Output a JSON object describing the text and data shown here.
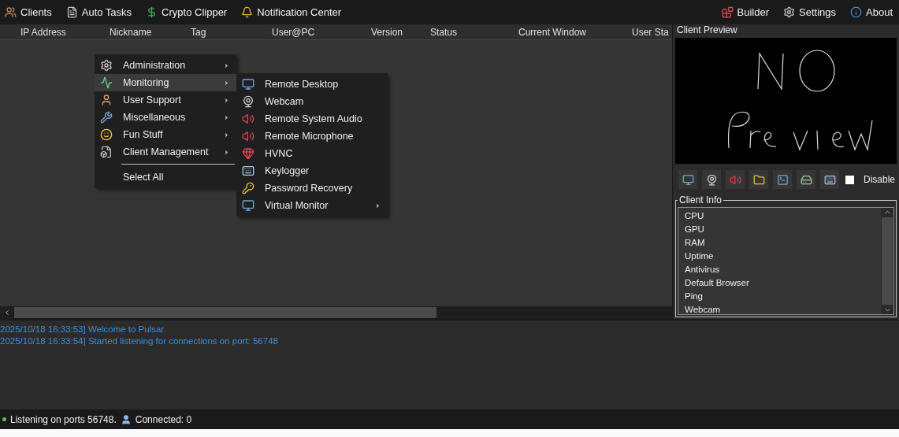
{
  "menubar": {
    "left": [
      {
        "label": "Clients"
      },
      {
        "label": "Auto Tasks"
      },
      {
        "label": "Crypto Clipper"
      },
      {
        "label": "Notification Center"
      }
    ],
    "right": [
      {
        "label": "Builder"
      },
      {
        "label": "Settings"
      },
      {
        "label": "About"
      }
    ]
  },
  "clients_table": {
    "columns": [
      "IP Address",
      "Nickname",
      "Tag",
      "User@PC",
      "Version",
      "Status",
      "Current Window",
      "User Sta"
    ]
  },
  "context_menu": {
    "items": [
      {
        "kind": "item",
        "label": "Administration",
        "has_submenu": true,
        "selected": false
      },
      {
        "kind": "item",
        "label": "Monitoring",
        "has_submenu": true,
        "selected": true
      },
      {
        "kind": "item",
        "label": "User Support",
        "has_submenu": true,
        "selected": false
      },
      {
        "kind": "item",
        "label": "Miscellaneous",
        "has_submenu": true,
        "selected": false
      },
      {
        "kind": "item",
        "label": "Fun Stuff",
        "has_submenu": true,
        "selected": false
      },
      {
        "kind": "item",
        "label": "Client Management",
        "has_submenu": true,
        "selected": false
      },
      {
        "kind": "separator"
      },
      {
        "kind": "item",
        "label": "Select All",
        "has_submenu": false,
        "selected": false
      }
    ],
    "submenu": [
      {
        "label": "Remote Desktop",
        "has_submenu": false
      },
      {
        "label": "Webcam",
        "has_submenu": false
      },
      {
        "label": "Remote System Audio",
        "has_submenu": false
      },
      {
        "label": "Remote Microphone",
        "has_submenu": false
      },
      {
        "label": "HVNC",
        "has_submenu": false
      },
      {
        "label": "Keylogger",
        "has_submenu": false
      },
      {
        "label": "Password Recovery",
        "has_submenu": false
      },
      {
        "label": "Virtual Monitor",
        "has_submenu": true
      }
    ]
  },
  "client_preview": {
    "title": "Client Preview",
    "disable": {
      "label": "Disable",
      "checked": false
    }
  },
  "client_info": {
    "title": "Client Info",
    "items": [
      "CPU",
      "GPU",
      "RAM",
      "Uptime",
      "Antivirus",
      "Default Browser",
      "Ping",
      "Webcam"
    ]
  },
  "log": [
    "2025/10/18 16:33:53] Welcome to Pulsar.",
    "2025/10/18 16:33:54] Started listening for connections on port: 56748"
  ],
  "status_bar": {
    "listening": "Listening on ports 56748.",
    "connected": "Connected: 0"
  }
}
